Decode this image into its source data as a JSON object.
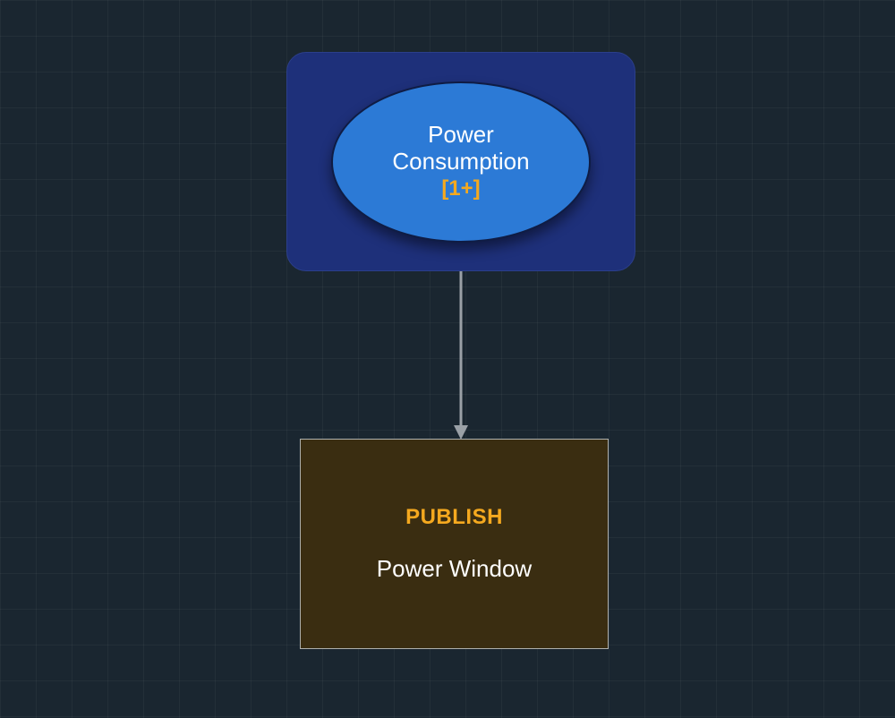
{
  "diagram": {
    "node_a": {
      "title_line1": "Power",
      "title_line2": "Consumption",
      "tag": "[1+]"
    },
    "node_b": {
      "heading": "PUBLISH",
      "label": "Power Window"
    }
  }
}
